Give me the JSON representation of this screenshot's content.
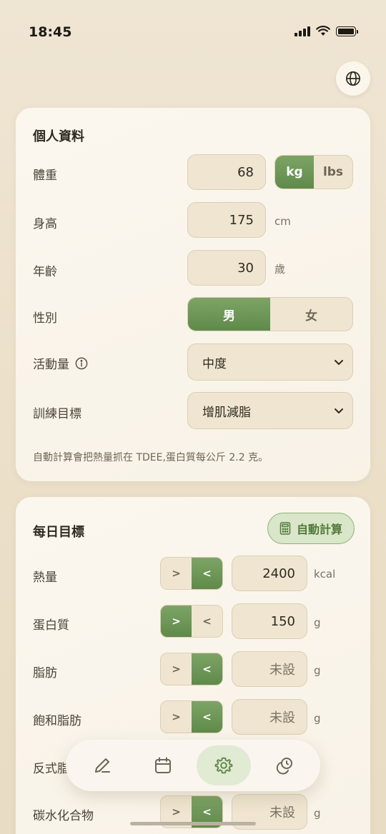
{
  "status": {
    "time": "18:45"
  },
  "profile": {
    "title": "個人資料",
    "weight": {
      "label": "體重",
      "value": "68",
      "units": [
        "kg",
        "lbs"
      ],
      "selected_unit": "kg"
    },
    "height": {
      "label": "身高",
      "value": "175",
      "unit": "cm"
    },
    "age": {
      "label": "年齡",
      "value": "30",
      "unit": "歲"
    },
    "gender": {
      "label": "性別",
      "options": [
        "男",
        "女"
      ],
      "selected": "男"
    },
    "activity": {
      "label": "活動量",
      "value": "中度"
    },
    "goal": {
      "label": "訓練目標",
      "value": "增肌減脂"
    },
    "hint": "自動計算會把熱量抓在 TDEE,蛋白質每公斤 2.2 克。"
  },
  "daily": {
    "title": "每日目標",
    "auto_button": "自動計算",
    "rows": [
      {
        "label": "熱量",
        "cmp": "<",
        "value": "2400",
        "unit": "kcal"
      },
      {
        "label": "蛋白質",
        "cmp": ">",
        "value": "150",
        "unit": "g"
      },
      {
        "label": "脂肪",
        "cmp": "<",
        "value": "未設",
        "unit": "g"
      },
      {
        "label": "飽和脂肪",
        "cmp": "<",
        "value": "未設",
        "unit": "g"
      },
      {
        "label": "反式脂",
        "cmp": "<",
        "value": "",
        "unit": ""
      },
      {
        "label": "碳水化合物",
        "cmp": "<",
        "value": "未設",
        "unit": "g"
      }
    ],
    "cmp_options": [
      ">",
      "<"
    ]
  },
  "tabbar": {
    "tabs": [
      {
        "icon": "pencil-icon"
      },
      {
        "icon": "calendar-icon"
      },
      {
        "icon": "gear-icon",
        "active": true
      },
      {
        "icon": "history-icon"
      }
    ]
  },
  "colors": {
    "accent": "#6b9553",
    "background": "#ece1cb",
    "card": "#faf6ee"
  }
}
